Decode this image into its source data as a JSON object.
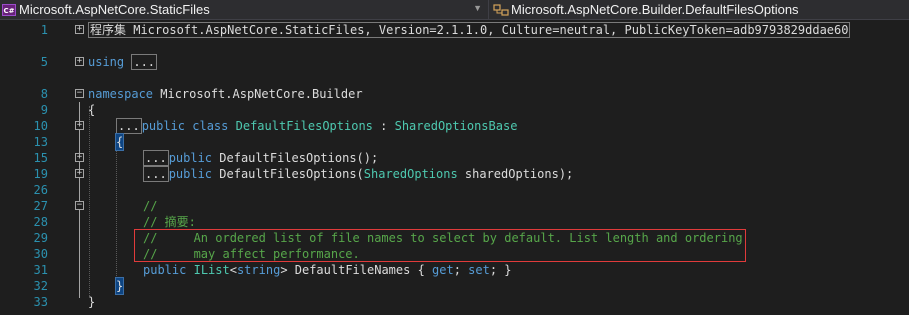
{
  "nav": {
    "left_icon": "C#",
    "left_label": "Microsoft.AspNetCore.StaticFiles",
    "right_label": "Microsoft.AspNetCore.Builder.DefaultFilesOptions"
  },
  "lines": {
    "l1": {
      "num": "1",
      "text": "程序集 Microsoft.AspNetCore.StaticFiles, Version=2.1.1.0, Culture=neutral, PublicKeyToken=adb9793829ddae60"
    },
    "l5": {
      "num": "5",
      "kw": "using",
      "collapsed": "..."
    },
    "l8": {
      "num": "8",
      "kw": "namespace",
      "text": " Microsoft.AspNetCore.Builder"
    },
    "l9": {
      "num": "9",
      "text": "{"
    },
    "l10": {
      "num": "10",
      "collapsed": "...",
      "kw": "public class",
      "type": "DefaultFilesOptions",
      "sep": " : ",
      "base": "SharedOptionsBase"
    },
    "l13": {
      "num": "13",
      "text": "{"
    },
    "l15": {
      "num": "15",
      "collapsed": "...",
      "kw": "public",
      "text": " DefaultFilesOptions();"
    },
    "l19": {
      "num": "19",
      "collapsed": "...",
      "kw": "public",
      "text1": " DefaultFilesOptions(",
      "type": "SharedOptions",
      "text2": " sharedOptions);"
    },
    "l26": {
      "num": "26",
      "text": ""
    },
    "l27": {
      "num": "27",
      "cm": "//"
    },
    "l28": {
      "num": "28",
      "cm": "// 摘要:"
    },
    "l29": {
      "num": "29",
      "cm": "//     An ordered list of file names to select by default. List length and ordering"
    },
    "l30": {
      "num": "30",
      "cm": "//     may affect performance."
    },
    "l31": {
      "num": "31",
      "kw": "public",
      "type": "IList",
      "lt": "<",
      "kw2": "string",
      "rest": "> DefaultFileNames { ",
      "get": "get",
      "semi1": "; ",
      "set": "set",
      "semi2": "; }"
    },
    "l32": {
      "num": "32",
      "text": "}"
    },
    "l33": {
      "num": "33",
      "text": "}"
    }
  },
  "colors": {
    "keyword": "#569cd6",
    "type": "#4ec9b0",
    "comment": "#57a64a",
    "line_number": "#2b91af",
    "highlight_box": "#e03b3b"
  }
}
